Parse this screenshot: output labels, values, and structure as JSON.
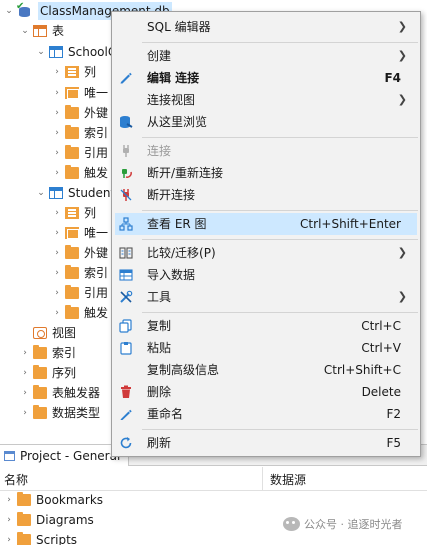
{
  "tree": {
    "root": "ClassManagement.db",
    "tables": "表",
    "table1": "SchoolC",
    "t1_children": [
      "列",
      "唯一",
      "外键",
      "索引",
      "引用",
      "触发"
    ],
    "table2": "Student",
    "t2_children": [
      "列",
      "唯一",
      "外键",
      "索引",
      "引用",
      "触发"
    ],
    "siblings": [
      "视图",
      "索引",
      "序列",
      "表触发器",
      "数据类型"
    ]
  },
  "context_menu": {
    "sql_editor": "SQL 编辑器",
    "create": "创建",
    "edit_connection": "编辑 连接",
    "edit_connection_shortcut": "F4",
    "connection_view": "连接视图",
    "browse_from_here": "从这里浏览",
    "connect": "连接",
    "reconnect": "断开/重新连接",
    "disconnect": "断开连接",
    "view_er": "查看 ER 图",
    "view_er_shortcut": "Ctrl+Shift+Enter",
    "compare_migrate": "比较/迁移(P)",
    "import_data": "导入数据",
    "tools": "工具",
    "copy": "复制",
    "copy_shortcut": "Ctrl+C",
    "paste": "粘贴",
    "paste_shortcut": "Ctrl+V",
    "copy_advanced": "复制高级信息",
    "copy_advanced_shortcut": "Ctrl+Shift+C",
    "delete": "删除",
    "delete_shortcut": "Delete",
    "rename": "重命名",
    "rename_shortcut": "F2",
    "refresh": "刷新",
    "refresh_shortcut": "F5"
  },
  "bottom": {
    "tab_title": "Project - General",
    "col_name": "名称",
    "col_datasource": "数据源",
    "items": [
      "Bookmarks",
      "Diagrams",
      "Scripts"
    ]
  },
  "watermark": "公众号 · 追逐时光者",
  "colors": {
    "highlight": "#cde8ff",
    "menu_bg": "#f2f2f2",
    "folder": "#f0a03c",
    "table_icon": "#2d7fd0"
  }
}
